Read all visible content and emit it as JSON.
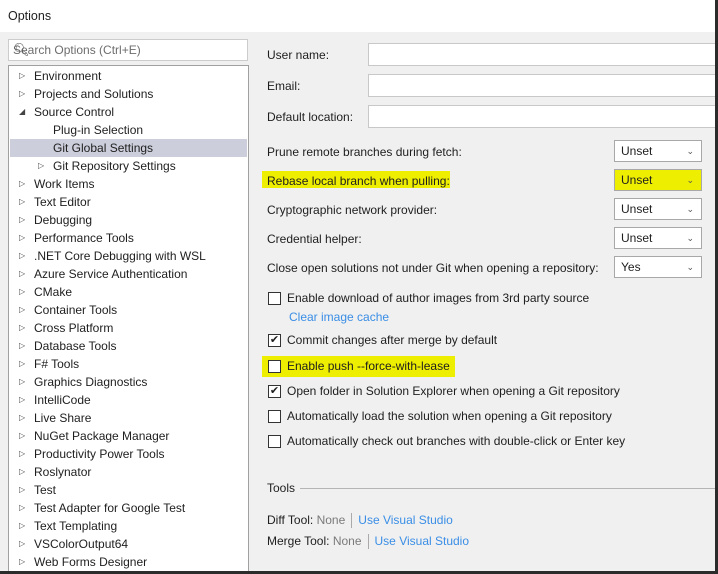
{
  "window": {
    "title": "Options"
  },
  "search": {
    "placeholder": "Search Options (Ctrl+E)"
  },
  "tree": [
    {
      "label": "Environment",
      "level": 0,
      "arrow": "collapsed"
    },
    {
      "label": "Projects and Solutions",
      "level": 0,
      "arrow": "collapsed"
    },
    {
      "label": "Source Control",
      "level": 0,
      "arrow": "expanded"
    },
    {
      "label": "Plug-in Selection",
      "level": 1,
      "arrow": ""
    },
    {
      "label": "Git Global Settings",
      "level": 1,
      "arrow": "",
      "selected": true
    },
    {
      "label": "Git Repository Settings",
      "level": 1,
      "arrow": "collapsed"
    },
    {
      "label": "Work Items",
      "level": 0,
      "arrow": "collapsed"
    },
    {
      "label": "Text Editor",
      "level": 0,
      "arrow": "collapsed"
    },
    {
      "label": "Debugging",
      "level": 0,
      "arrow": "collapsed"
    },
    {
      "label": "Performance Tools",
      "level": 0,
      "arrow": "collapsed"
    },
    {
      "label": ".NET Core Debugging with WSL",
      "level": 0,
      "arrow": "collapsed"
    },
    {
      "label": "Azure Service Authentication",
      "level": 0,
      "arrow": "collapsed"
    },
    {
      "label": "CMake",
      "level": 0,
      "arrow": "collapsed"
    },
    {
      "label": "Container Tools",
      "level": 0,
      "arrow": "collapsed"
    },
    {
      "label": "Cross Platform",
      "level": 0,
      "arrow": "collapsed"
    },
    {
      "label": "Database Tools",
      "level": 0,
      "arrow": "collapsed"
    },
    {
      "label": "F# Tools",
      "level": 0,
      "arrow": "collapsed"
    },
    {
      "label": "Graphics Diagnostics",
      "level": 0,
      "arrow": "collapsed"
    },
    {
      "label": "IntelliCode",
      "level": 0,
      "arrow": "collapsed"
    },
    {
      "label": "Live Share",
      "level": 0,
      "arrow": "collapsed"
    },
    {
      "label": "NuGet Package Manager",
      "level": 0,
      "arrow": "collapsed"
    },
    {
      "label": "Productivity Power Tools",
      "level": 0,
      "arrow": "collapsed"
    },
    {
      "label": "Roslynator",
      "level": 0,
      "arrow": "collapsed"
    },
    {
      "label": "Test",
      "level": 0,
      "arrow": "collapsed"
    },
    {
      "label": "Test Adapter for Google Test",
      "level": 0,
      "arrow": "collapsed"
    },
    {
      "label": "Text Templating",
      "level": 0,
      "arrow": "collapsed"
    },
    {
      "label": "VSColorOutput64",
      "level": 0,
      "arrow": "collapsed"
    },
    {
      "label": "Web Forms Designer",
      "level": 0,
      "arrow": "collapsed"
    }
  ],
  "fields": {
    "user_name": "User name:",
    "email": "Email:",
    "default_location": "Default location:",
    "user_name_value": "",
    "email_value": "",
    "default_location_value": ""
  },
  "dropdowns": [
    {
      "label": "Prune remote branches during fetch:",
      "value": "Unset",
      "highlight": false
    },
    {
      "label": "Rebase local branch when pulling:",
      "value": "Unset",
      "highlight": true
    },
    {
      "label": "Cryptographic network provider:",
      "value": "Unset",
      "highlight": false
    },
    {
      "label": "Credential helper:",
      "value": "Unset",
      "highlight": false
    },
    {
      "label": "Close open solutions not under Git when opening a repository:",
      "value": "Yes",
      "highlight": false
    }
  ],
  "clear_cache": "Clear image cache",
  "checkboxes": [
    {
      "label": "Enable download of author images from 3rd party source",
      "checked": false
    },
    {
      "label": "Commit changes after merge by default",
      "checked": true
    },
    {
      "label": "Enable push --force-with-lease",
      "checked": false,
      "highlight": true
    },
    {
      "label": "Open folder in Solution Explorer when opening a Git repository",
      "checked": true
    },
    {
      "label": "Automatically load the solution when opening a Git repository",
      "checked": false
    },
    {
      "label": "Automatically check out branches with double-click or Enter key",
      "checked": false
    }
  ],
  "tools": {
    "heading": "Tools",
    "diff_label": "Diff Tool:",
    "diff_value": "None",
    "diff_link": "Use Visual Studio",
    "merge_label": "Merge Tool:",
    "merge_value": "None",
    "merge_link": "Use Visual Studio"
  },
  "colors": {
    "highlight": "#eeee00",
    "link": "#3a8ee6",
    "selected": "#cccedb"
  }
}
